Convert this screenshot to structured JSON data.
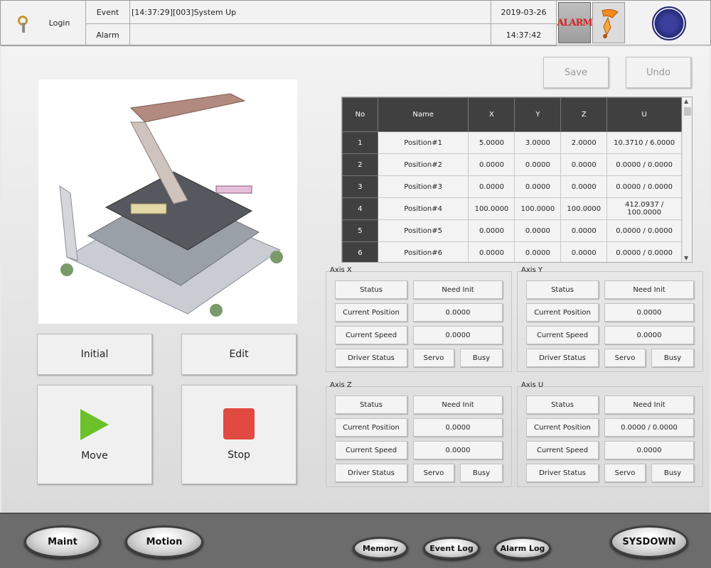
{
  "header": {
    "login_label": "Login",
    "event_label": "Event",
    "alarm_label": "Alarm",
    "event_message": "[14:37:29][003]System Up",
    "alarm_message": "",
    "date": "2019-03-26",
    "time": "14:37:42",
    "alarm_button": "ALARM"
  },
  "toolbar": {
    "save": "Save",
    "undo": "Undo"
  },
  "controls": {
    "initial": "Initial",
    "edit": "Edit",
    "move": "Move",
    "stop": "Stop"
  },
  "table": {
    "headers": [
      "No",
      "Name",
      "X",
      "Y",
      "Z",
      "U"
    ],
    "rows": [
      [
        "1",
        "Position#1",
        "5.0000",
        "3.0000",
        "2.0000",
        "10.3710 / 6.0000"
      ],
      [
        "2",
        "Position#2",
        "0.0000",
        "0.0000",
        "0.0000",
        "0.0000 / 0.0000"
      ],
      [
        "3",
        "Position#3",
        "0.0000",
        "0.0000",
        "0.0000",
        "0.0000 / 0.0000"
      ],
      [
        "4",
        "Position#4",
        "100.0000",
        "100.0000",
        "100.0000",
        "412.0937 / 100.0000"
      ],
      [
        "5",
        "Position#5",
        "0.0000",
        "0.0000",
        "0.0000",
        "0.0000 / 0.0000"
      ],
      [
        "6",
        "Position#6",
        "0.0000",
        "0.0000",
        "0.0000",
        "0.0000 / 0.0000"
      ]
    ]
  },
  "axis_labels": {
    "status": "Status",
    "current_position": "Current Position",
    "current_speed": "Current Speed",
    "driver_status": "Driver Status",
    "servo": "Servo",
    "busy": "Busy"
  },
  "axes": {
    "x": {
      "title": "Axis X",
      "status": "Need Init",
      "position": "0.0000",
      "speed": "0.0000"
    },
    "y": {
      "title": "Axis Y",
      "status": "Need Init",
      "position": "0.0000",
      "speed": "0.0000"
    },
    "z": {
      "title": "Axis Z",
      "status": "Need Init",
      "position": "0.0000",
      "speed": "0.0000"
    },
    "u": {
      "title": "Axis U",
      "status": "Need Init",
      "position": "0.0000 / 0.0000",
      "speed": "0.0000"
    }
  },
  "footer": {
    "maint": "Maint",
    "motion": "Motion",
    "memory": "Memory",
    "event_log": "Event Log",
    "alarm_log": "Alarm Log",
    "sysdown": "SYSDOWN"
  },
  "colors": {
    "play_green": "#6cc12a",
    "stop_red": "#e04a40",
    "table_header": "#404040"
  },
  "icons": {
    "login": "key-icon",
    "alarm": "alarm-icon",
    "horn": "horn-icon",
    "logo": "institute-logo"
  }
}
